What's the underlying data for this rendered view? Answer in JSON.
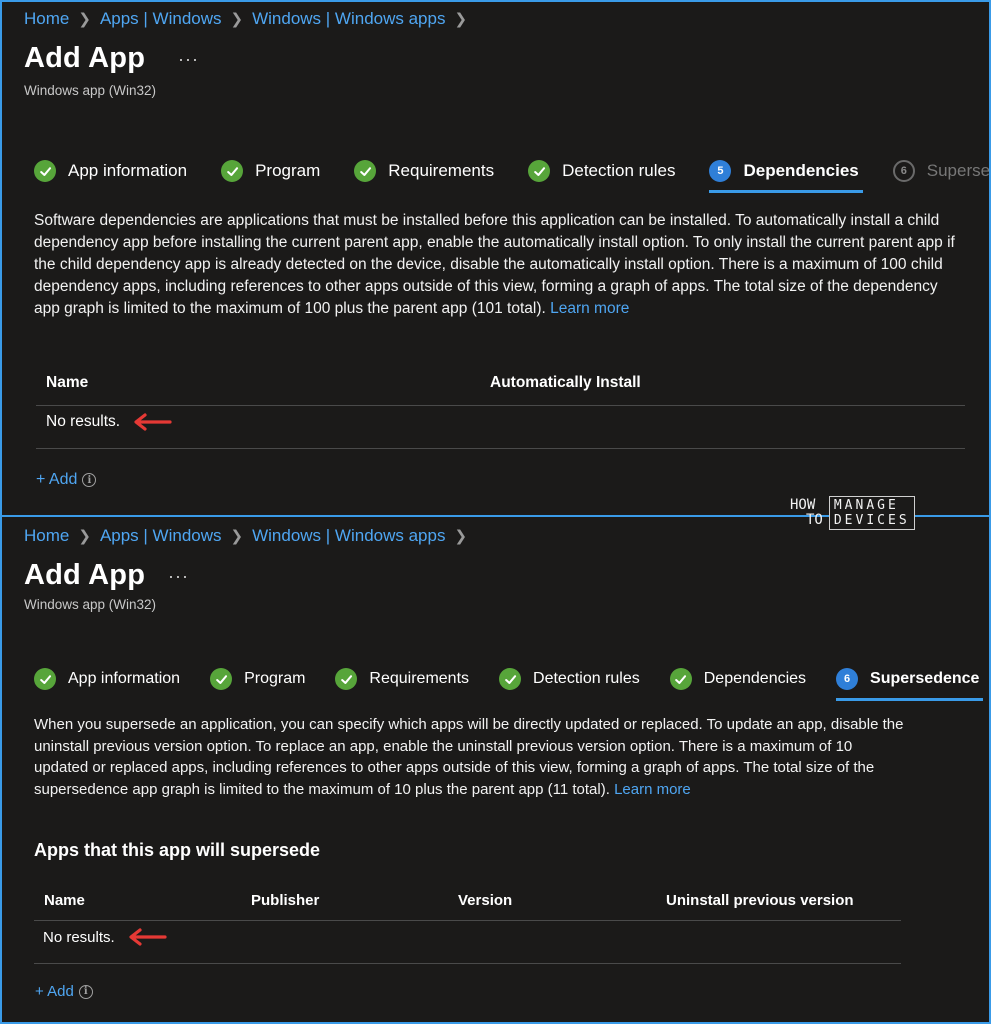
{
  "top": {
    "breadcrumb": [
      "Home",
      "Apps | Windows",
      "Windows | Windows apps"
    ],
    "title": "Add App",
    "more": "···",
    "subtitle": "Windows app (Win32)",
    "steps": [
      {
        "label": "App information",
        "state": "done"
      },
      {
        "label": "Program",
        "state": "done"
      },
      {
        "label": "Requirements",
        "state": "done"
      },
      {
        "label": "Detection rules",
        "state": "done"
      },
      {
        "label": "Dependencies",
        "state": "active",
        "number": "5"
      },
      {
        "label": "Superse",
        "state": "inactive",
        "number": "6"
      }
    ],
    "description": "Software dependencies are applications that must be installed before this application can be installed. To automatically install a child dependency app before installing the current parent app, enable the automatically install option. To only install the current parent app if the child dependency app is already detected on the device, disable the automatically install option. There is a maximum of 100 child dependency apps, including references to other apps outside of this view, forming a graph of apps. The total size of the dependency app graph is limited to the maximum of 100 plus the parent app (101 total).",
    "learn_more": "Learn more",
    "columns": [
      "Name",
      "Automatically Install"
    ],
    "no_results": "No results.",
    "add": "+ Add"
  },
  "bottom": {
    "breadcrumb": [
      "Home",
      "Apps | Windows",
      "Windows | Windows apps"
    ],
    "title": "Add App",
    "more": "···",
    "subtitle": "Windows app (Win32)",
    "steps": [
      {
        "label": "App information",
        "state": "done"
      },
      {
        "label": "Program",
        "state": "done"
      },
      {
        "label": "Requirements",
        "state": "done"
      },
      {
        "label": "Detection rules",
        "state": "done"
      },
      {
        "label": "Dependencies",
        "state": "done"
      },
      {
        "label": "Supersedence",
        "state": "active",
        "number": "6"
      }
    ],
    "description": "When you supersede an application, you can specify which apps will be directly updated or replaced. To update an app, disable the uninstall previous version option. To replace an app, enable the uninstall previous version option. There is a maximum of 10 updated or replaced apps, including references to other apps outside of this view, forming a graph of apps. The total size of the supersedence app graph is limited to the maximum of 10 plus the parent app (11 total).",
    "learn_more": "Learn more",
    "section_title": "Apps that this app will supersede",
    "columns": [
      "Name",
      "Publisher",
      "Version",
      "Uninstall previous version"
    ],
    "no_results": "No results.",
    "add": "+ Add"
  },
  "watermark": {
    "how": "HOW",
    "to": "TO",
    "manage": "MANAGE",
    "devices": "DEVICES"
  },
  "colors": {
    "accent": "#3a9be8",
    "link": "#4fa6f2",
    "check": "#57a53a",
    "arrow": "#e53935",
    "background": "#1b1a19"
  }
}
